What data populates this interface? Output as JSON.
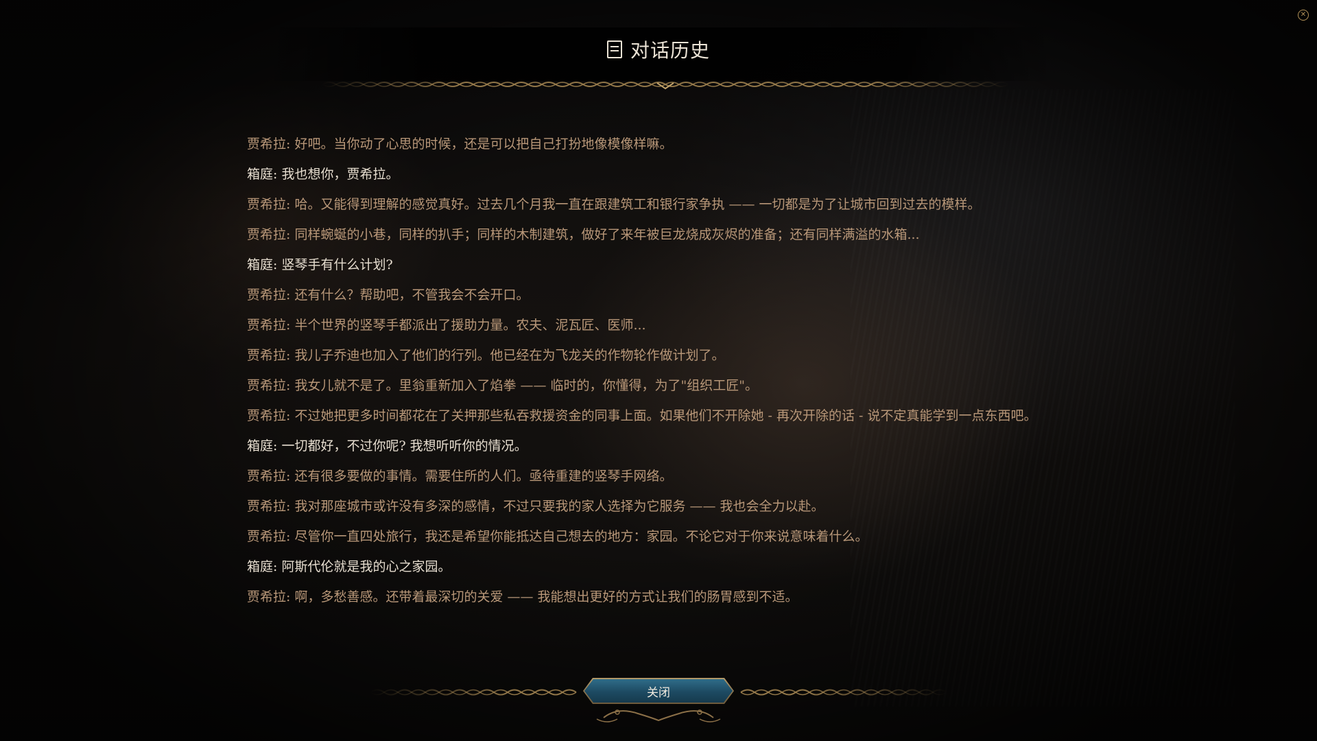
{
  "window": {
    "title": "对话历史",
    "title_icon": "log-icon",
    "corner_icon": "badge-icon"
  },
  "dialogue": [
    {
      "speaker": "贾希拉",
      "text": "贾希拉: 好吧。当你动了心思的时候，还是可以把自己打扮地像模像样嘛。",
      "player": false
    },
    {
      "speaker": "箱庭",
      "text": "箱庭: 我也想你，贾希拉。",
      "player": true
    },
    {
      "speaker": "贾希拉",
      "text": "贾希拉: 哈。又能得到理解的感觉真好。过去几个月我一直在跟建筑工和银行家争执 —— 一切都是为了让城市回到过去的模样。",
      "player": false
    },
    {
      "speaker": "贾希拉",
      "text": "贾希拉: 同样蜿蜒的小巷，同样的扒手；同样的木制建筑，做好了来年被巨龙烧成灰烬的准备；还有同样满溢的水箱...",
      "player": false
    },
    {
      "speaker": "箱庭",
      "text": "箱庭: 竖琴手有什么计划?",
      "player": true
    },
    {
      "speaker": "贾希拉",
      "text": "贾希拉: 还有什么？帮助吧，不管我会不会开口。",
      "player": false
    },
    {
      "speaker": "贾希拉",
      "text": "贾希拉: 半个世界的竖琴手都派出了援助力量。农夫、泥瓦匠、医师...",
      "player": false
    },
    {
      "speaker": "贾希拉",
      "text": "贾希拉: 我儿子乔迪也加入了他们的行列。他已经在为飞龙关的作物轮作做计划了。",
      "player": false
    },
    {
      "speaker": "贾希拉",
      "text": "贾希拉: 我女儿就不是了。里翁重新加入了焰拳 —— 临时的，你懂得，为了\"组织工匠\"。",
      "player": false
    },
    {
      "speaker": "贾希拉",
      "text": "贾希拉: 不过她把更多时间都花在了关押那些私吞救援资金的同事上面。如果他们不开除她 - 再次开除的话 - 说不定真能学到一点东西吧。",
      "player": false
    },
    {
      "speaker": "箱庭",
      "text": "箱庭: 一切都好，不过你呢? 我想听听你的情况。",
      "player": true
    },
    {
      "speaker": "贾希拉",
      "text": "贾希拉: 还有很多要做的事情。需要住所的人们。亟待重建的竖琴手网络。",
      "player": false
    },
    {
      "speaker": "贾希拉",
      "text": "贾希拉: 我对那座城市或许没有多深的感情，不过只要我的家人选择为它服务 —— 我也会全力以赴。",
      "player": false
    },
    {
      "speaker": "贾希拉",
      "text": "贾希拉: 尽管你一直四处旅行，我还是希望你能抵达自己想去的地方：家园。不论它对于你来说意味着什么。",
      "player": false
    },
    {
      "speaker": "箱庭",
      "text": "箱庭: 阿斯代伦就是我的心之家园。",
      "player": true
    },
    {
      "speaker": "贾希拉",
      "text": "贾希拉: 啊，多愁善感。还带着最深切的关爱 —— 我能想出更好的方式让我们的肠胃感到不适。",
      "player": false
    }
  ],
  "footer": {
    "close_label": "关闭"
  },
  "colors": {
    "npc_text": "#b89778",
    "player_text": "#e6ddcf",
    "button_fill": "#1d4a62",
    "ornament": "#a0824f"
  }
}
